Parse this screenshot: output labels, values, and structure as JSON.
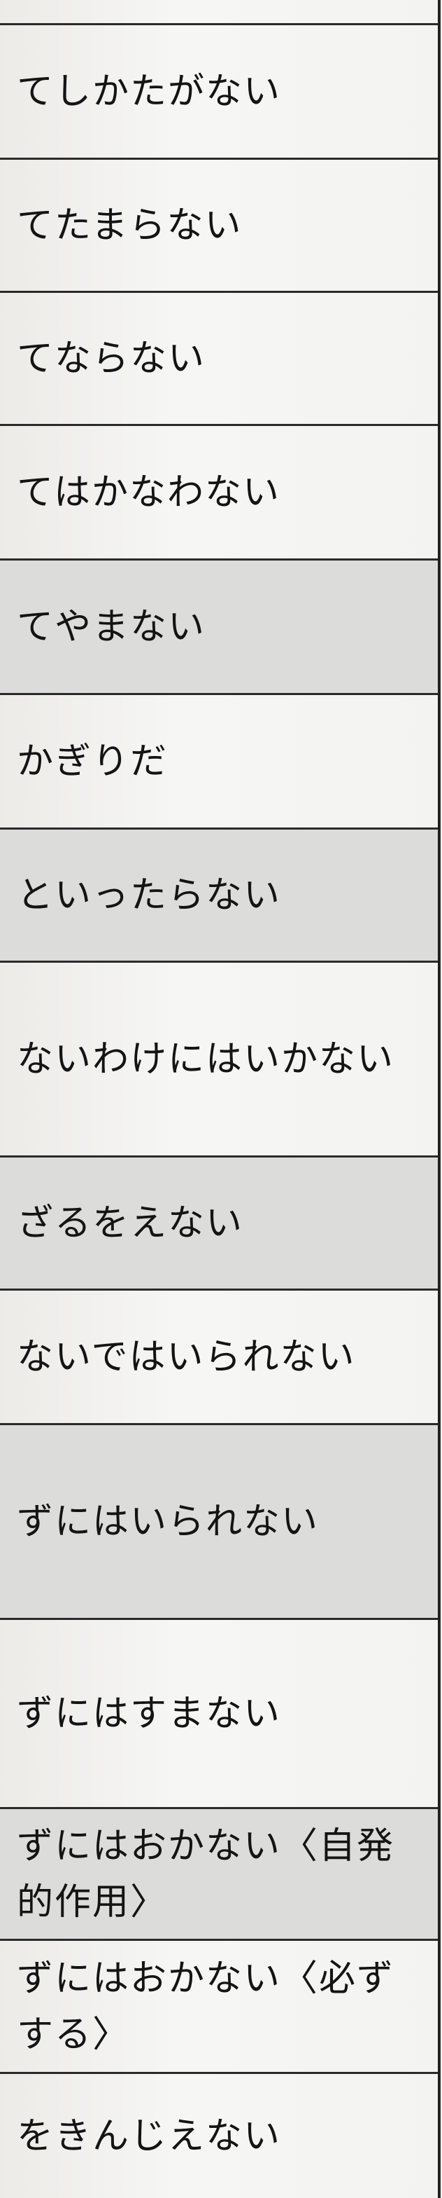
{
  "rows": [
    {
      "text": "てしかたがない",
      "shade": false
    },
    {
      "text": "てたまらない",
      "shade": false
    },
    {
      "text": "てならない",
      "shade": false
    },
    {
      "text": "てはかなわない",
      "shade": false
    },
    {
      "text": "てやまない",
      "shade": true
    },
    {
      "text": "かぎりだ",
      "shade": false
    },
    {
      "text": "といったらない",
      "shade": true
    },
    {
      "text": "ないわけにはいかない",
      "shade": false
    },
    {
      "text": "ざるをえない",
      "shade": true
    },
    {
      "text": "ないではいられない",
      "shade": false
    },
    {
      "text": "ずにはいられない",
      "shade": true
    },
    {
      "text": "ずにはすまない",
      "shade": false
    },
    {
      "text": "ずにはおかない〈自発的作用〉",
      "shade": true
    },
    {
      "text": "ずにはおかない〈必ずする〉",
      "shade": false
    },
    {
      "text": "をきんじえない",
      "shade": false
    }
  ]
}
